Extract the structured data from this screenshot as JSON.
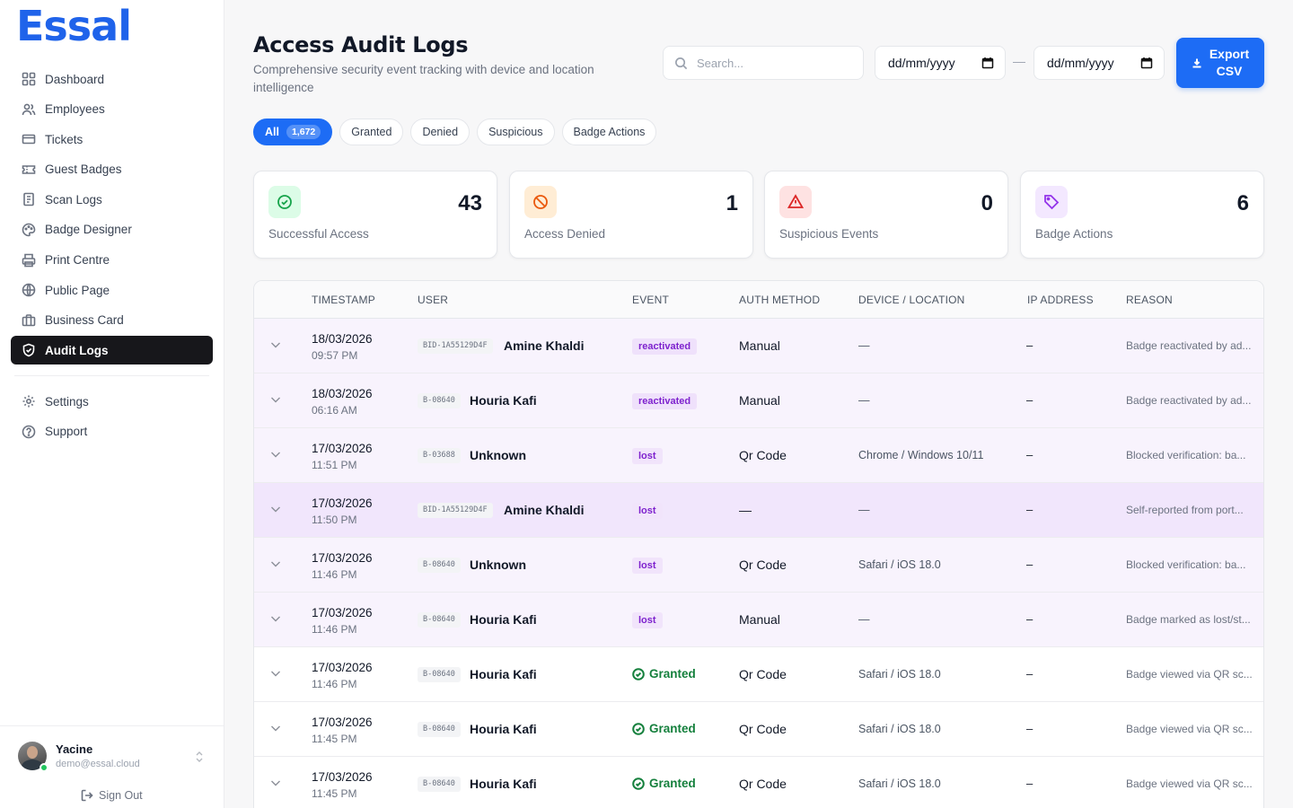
{
  "app": {
    "logo": "Essal"
  },
  "sidebar": {
    "items": [
      {
        "label": "Dashboard",
        "icon": "grid-icon"
      },
      {
        "label": "Employees",
        "icon": "users-icon"
      },
      {
        "label": "Tickets",
        "icon": "ticket-icon"
      },
      {
        "label": "Guest Badges",
        "icon": "badge-icon"
      },
      {
        "label": "Scan Logs",
        "icon": "scan-icon"
      },
      {
        "label": "Badge Designer",
        "icon": "palette-icon"
      },
      {
        "label": "Print Centre",
        "icon": "printer-icon"
      },
      {
        "label": "Public Page",
        "icon": "globe-icon"
      },
      {
        "label": "Business Card",
        "icon": "card-icon"
      },
      {
        "label": "Audit Logs",
        "icon": "shield-icon",
        "active": true
      }
    ],
    "secondary": [
      {
        "label": "Settings",
        "icon": "gear-icon"
      },
      {
        "label": "Support",
        "icon": "help-icon"
      }
    ],
    "user": {
      "name": "Yacine",
      "email": "demo@essal.cloud",
      "status": "online"
    },
    "signout": "Sign Out"
  },
  "header": {
    "title": "Access Audit Logs",
    "subtitle": "Comprehensive security event tracking with device and location intelligence",
    "search_placeholder": "Search...",
    "date_from": "dd/mm/yyyy",
    "date_sep": "—",
    "date_to": "dd/mm/yyyy",
    "export_line1": "Export",
    "export_line2": "CSV"
  },
  "filters": {
    "all": "All",
    "all_count": "1,672",
    "granted": "Granted",
    "denied": "Denied",
    "suspicious": "Suspicious",
    "badge_actions": "Badge Actions"
  },
  "stats": [
    {
      "value": "43",
      "label": "Successful Access",
      "color": "#16a34a",
      "bg": "#dcfce7"
    },
    {
      "value": "1",
      "label": "Access Denied",
      "color": "#ea580c",
      "bg": "#ffedd5"
    },
    {
      "value": "0",
      "label": "Suspicious Events",
      "color": "#dc2626",
      "bg": "#fee2e2"
    },
    {
      "value": "6",
      "label": "Badge Actions",
      "color": "#9333ea",
      "bg": "#f3e8ff"
    }
  ],
  "table": {
    "headers": {
      "timestamp": "TIMESTAMP",
      "user": "USER",
      "event": "EVENT",
      "auth": "AUTH METHOD",
      "device": "DEVICE / LOCATION",
      "ip": "IP ADDRESS",
      "reason": "REASON"
    },
    "rows": [
      {
        "date": "18/03/2026",
        "time": "09:57 PM",
        "badge_id": "BID-1A55129D4F",
        "user": "Amine Khaldi",
        "event": "reactivated",
        "auth": "Manual",
        "device": "—",
        "ip": "–",
        "reason": "Badge reactivated by ad..."
      },
      {
        "date": "18/03/2026",
        "time": "06:16 AM",
        "badge_id": "B-08640",
        "user": "Houria Kafi",
        "event": "reactivated",
        "auth": "Manual",
        "device": "—",
        "ip": "–",
        "reason": "Badge reactivated by ad..."
      },
      {
        "date": "17/03/2026",
        "time": "11:51 PM",
        "badge_id": "B-03688",
        "user": "Unknown",
        "event": "lost",
        "auth": "Qr Code",
        "device": "Chrome / Windows 10/11",
        "ip": "–",
        "reason": "Blocked verification: ba..."
      },
      {
        "date": "17/03/2026",
        "time": "11:50 PM",
        "badge_id": "BID-1A55129D4F",
        "user": "Amine Khaldi",
        "event": "lost",
        "auth": "—",
        "device": "—",
        "ip": "–",
        "reason": "Self-reported from port..."
      },
      {
        "date": "17/03/2026",
        "time": "11:46 PM",
        "badge_id": "B-08640",
        "user": "Unknown",
        "event": "lost",
        "auth": "Qr Code",
        "device": "Safari / iOS 18.0",
        "ip": "–",
        "reason": "Blocked verification: ba..."
      },
      {
        "date": "17/03/2026",
        "time": "11:46 PM",
        "badge_id": "B-08640",
        "user": "Houria Kafi",
        "event": "lost",
        "auth": "Manual",
        "device": "—",
        "ip": "–",
        "reason": "Badge marked as lost/st..."
      },
      {
        "date": "17/03/2026",
        "time": "11:46 PM",
        "badge_id": "B-08640",
        "user": "Houria Kafi",
        "event": "Granted",
        "auth": "Qr Code",
        "device": "Safari / iOS 18.0",
        "ip": "–",
        "reason": "Badge viewed via QR sc..."
      },
      {
        "date": "17/03/2026",
        "time": "11:45 PM",
        "badge_id": "B-08640",
        "user": "Houria Kafi",
        "event": "Granted",
        "auth": "Qr Code",
        "device": "Safari / iOS 18.0",
        "ip": "–",
        "reason": "Badge viewed via QR sc..."
      },
      {
        "date": "17/03/2026",
        "time": "11:45 PM",
        "badge_id": "B-08640",
        "user": "Houria Kafi",
        "event": "Granted",
        "auth": "Qr Code",
        "device": "Safari / iOS 18.0",
        "ip": "–",
        "reason": "Badge viewed via QR sc..."
      }
    ]
  }
}
